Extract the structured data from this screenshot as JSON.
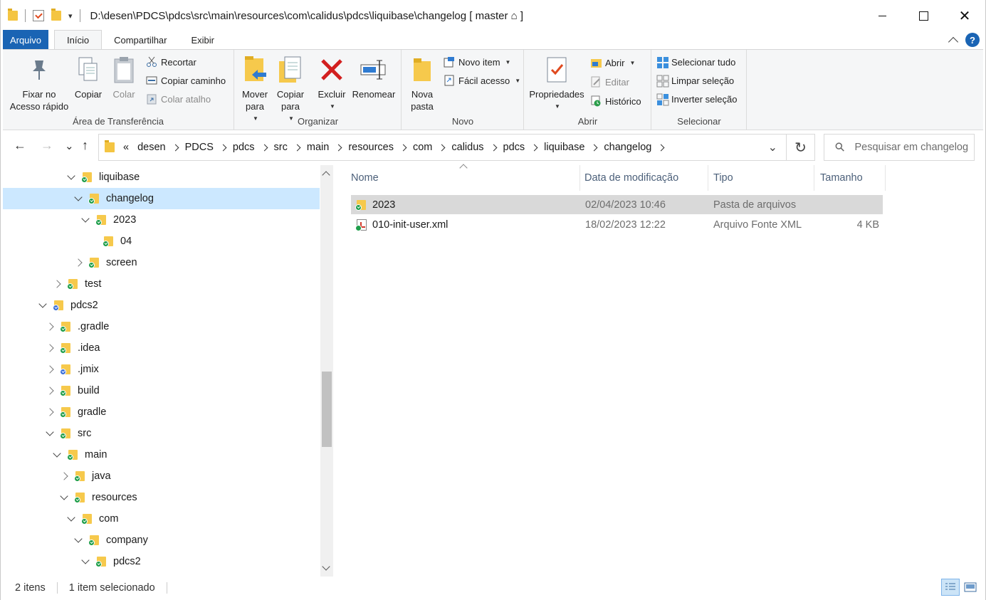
{
  "window": {
    "title": "D:\\desen\\PDCS\\pdcs\\src\\main\\resources\\com\\calidus\\pdcs\\liquibase\\changelog [ master ⌂ ]",
    "qa_dropdown": "▾",
    "controls": {
      "close": "✕"
    }
  },
  "ribbon": {
    "tabs": [
      "Arquivo",
      "Início",
      "Compartilhar",
      "Exibir"
    ],
    "help": "?",
    "clipboard": {
      "label": "Área de Transferência",
      "pin": "Fixar no\nAcesso rápido",
      "copy": "Copiar",
      "paste": "Colar",
      "cut": "Recortar",
      "copy_path": "Copiar caminho",
      "paste_shortcut": "Colar atalho"
    },
    "organize": {
      "label": "Organizar",
      "move_to": "Mover\npara",
      "copy_to": "Copiar\npara",
      "delete": "Excluir",
      "rename": "Renomear"
    },
    "new": {
      "label": "Novo",
      "new_folder": "Nova\npasta",
      "new_item": "Novo item",
      "easy_access": "Fácil acesso"
    },
    "open": {
      "label": "Abrir",
      "properties": "Propriedades",
      "open": "Abrir",
      "edit": "Editar",
      "history": "Histórico"
    },
    "select": {
      "label": "Selecionar",
      "select_all": "Selecionar tudo",
      "select_none": "Limpar seleção",
      "invert": "Inverter seleção"
    }
  },
  "navigation": {
    "back": "←",
    "forward": "→",
    "recent": "⌄",
    "up": "↑",
    "overflow": "«",
    "breadcrumbs": [
      "desen",
      "PDCS",
      "pdcs",
      "src",
      "main",
      "resources",
      "com",
      "calidus",
      "pdcs",
      "liquibase",
      "changelog"
    ],
    "dropdown": "⌄",
    "refresh": "↻",
    "search_icon": "⚲",
    "search_placeholder": "Pesquisar em changelog"
  },
  "tree": {
    "items": [
      {
        "label": "liquibase",
        "level": 4,
        "state": "expanded",
        "badge": "green",
        "selected": false
      },
      {
        "label": "changelog",
        "level": 5,
        "state": "expanded",
        "badge": "green",
        "selected": true
      },
      {
        "label": "2023",
        "level": 6,
        "state": "expanded",
        "badge": "green",
        "selected": false
      },
      {
        "label": "04",
        "level": 7,
        "state": "none",
        "badge": "green",
        "selected": false
      },
      {
        "label": "screen",
        "level": 5,
        "state": "collapsed",
        "badge": "green",
        "selected": false
      },
      {
        "label": "test",
        "level": 2,
        "state": "collapsed",
        "badge": "green",
        "selected": false
      },
      {
        "label": "pdcs2",
        "level": 0,
        "state": "expanded",
        "badge": "blue",
        "selected": false
      },
      {
        "label": ".gradle",
        "level": 1,
        "state": "collapsed",
        "badge": "green",
        "selected": false
      },
      {
        "label": ".idea",
        "level": 1,
        "state": "collapsed",
        "badge": "green",
        "selected": false
      },
      {
        "label": ".jmix",
        "level": 1,
        "state": "collapsed",
        "badge": "blue",
        "selected": false
      },
      {
        "label": "build",
        "level": 1,
        "state": "collapsed",
        "badge": "green",
        "selected": false
      },
      {
        "label": "gradle",
        "level": 1,
        "state": "collapsed",
        "badge": "green",
        "selected": false
      },
      {
        "label": "src",
        "level": 1,
        "state": "expanded",
        "badge": "green",
        "selected": false
      },
      {
        "label": "main",
        "level": 2,
        "state": "expanded",
        "badge": "green",
        "selected": false
      },
      {
        "label": "java",
        "level": 3,
        "state": "collapsed",
        "badge": "green",
        "selected": false
      },
      {
        "label": "resources",
        "level": 3,
        "state": "expanded",
        "badge": "green",
        "selected": false
      },
      {
        "label": "com",
        "level": 4,
        "state": "expanded",
        "badge": "green",
        "selected": false
      },
      {
        "label": "company",
        "level": 5,
        "state": "expanded",
        "badge": "green",
        "selected": false
      },
      {
        "label": "pdcs2",
        "level": 6,
        "state": "expanded",
        "badge": "green",
        "selected": false
      }
    ]
  },
  "files": {
    "columns": [
      "Nome",
      "Data de modificação",
      "Tipo",
      "Tamanho"
    ],
    "rows": [
      {
        "name": "2023",
        "date": "02/04/2023 10:46",
        "type": "Pasta de arquivos",
        "size": "",
        "kind": "folder",
        "selected": true
      },
      {
        "name": "010-init-user.xml",
        "date": "18/02/2023 12:22",
        "type": "Arquivo Fonte XML",
        "size": "4 KB",
        "kind": "xml",
        "selected": false
      }
    ]
  },
  "status": {
    "count": "2 itens",
    "selection": "1 item selecionado"
  }
}
